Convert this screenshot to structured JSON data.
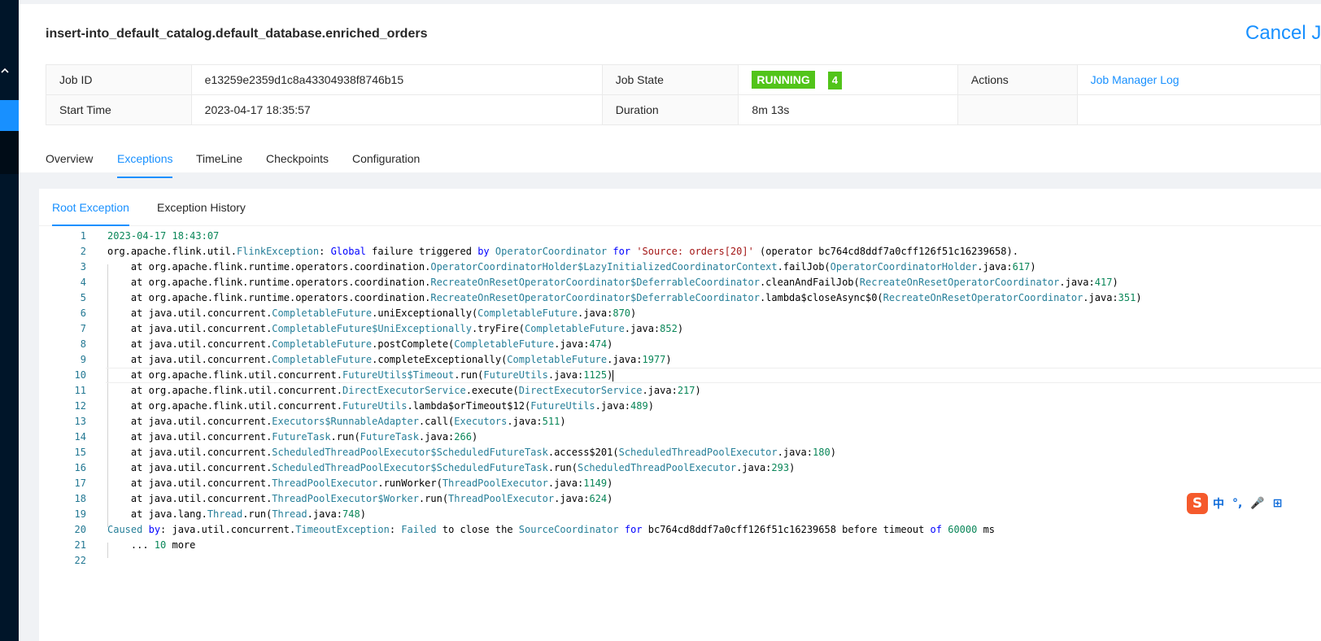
{
  "sidebar": {
    "collapse_icon": "chevron-up-icon"
  },
  "header": {
    "job_title": "insert-into_default_catalog.default_database.enriched_orders",
    "cancel_label": "Cancel Jo"
  },
  "job_info": {
    "job_id_label": "Job ID",
    "job_id": "e13259e2359d1c8a43304938f8746b15",
    "job_state_label": "Job State",
    "job_state": "RUNNING",
    "task_count": "4",
    "actions_label": "Actions",
    "job_manager_log": "Job Manager Log",
    "start_time_label": "Start Time",
    "start_time": "2023-04-17 18:35:57",
    "duration_label": "Duration",
    "duration": "8m 13s"
  },
  "nav_tabs": [
    "Overview",
    "Exceptions",
    "TimeLine",
    "Checkpoints",
    "Configuration"
  ],
  "sub_tabs": [
    "Root Exception",
    "Exception History"
  ],
  "code_lines": [
    [
      [
        "ts",
        "2023-04-17 18:43:07"
      ]
    ],
    [
      [
        "p",
        "org.apache.flink.util."
      ],
      [
        "t",
        "FlinkException"
      ],
      [
        "p",
        ": "
      ],
      [
        "k",
        "Global"
      ],
      [
        "p",
        " failure triggered "
      ],
      [
        "k",
        "by"
      ],
      [
        "p",
        " "
      ],
      [
        "t",
        "OperatorCoordinator"
      ],
      [
        "p",
        " "
      ],
      [
        "k",
        "for"
      ],
      [
        "p",
        " "
      ],
      [
        "s",
        "'Source: orders[20]'"
      ],
      [
        "p",
        " (operator bc764cd8ddf7a0cff126f51c16239658)."
      ]
    ],
    [
      [
        "p",
        "    at org.apache.flink.runtime.operators.coordination."
      ],
      [
        "t",
        "OperatorCoordinatorHolder$LazyInitializedCoordinatorContext"
      ],
      [
        "p",
        ".failJob("
      ],
      [
        "t",
        "OperatorCoordinatorHolder"
      ],
      [
        "p",
        ".java:"
      ],
      [
        "n",
        "617"
      ],
      [
        "p",
        ")"
      ]
    ],
    [
      [
        "p",
        "    at org.apache.flink.runtime.operators.coordination."
      ],
      [
        "t",
        "RecreateOnResetOperatorCoordinator$DeferrableCoordinator"
      ],
      [
        "p",
        ".cleanAndFailJob("
      ],
      [
        "t",
        "RecreateOnResetOperatorCoordinator"
      ],
      [
        "p",
        ".java:"
      ],
      [
        "n",
        "417"
      ],
      [
        "p",
        ")"
      ]
    ],
    [
      [
        "p",
        "    at org.apache.flink.runtime.operators.coordination."
      ],
      [
        "t",
        "RecreateOnResetOperatorCoordinator$DeferrableCoordinator"
      ],
      [
        "p",
        ".lambda$closeAsync$0("
      ],
      [
        "t",
        "RecreateOnResetOperatorCoordinator"
      ],
      [
        "p",
        ".java:"
      ],
      [
        "n",
        "351"
      ],
      [
        "p",
        ")"
      ]
    ],
    [
      [
        "p",
        "    at java.util.concurrent."
      ],
      [
        "t",
        "CompletableFuture"
      ],
      [
        "p",
        ".uniExceptionally("
      ],
      [
        "t",
        "CompletableFuture"
      ],
      [
        "p",
        ".java:"
      ],
      [
        "n",
        "870"
      ],
      [
        "p",
        ")"
      ]
    ],
    [
      [
        "p",
        "    at java.util.concurrent."
      ],
      [
        "t",
        "CompletableFuture$UniExceptionally"
      ],
      [
        "p",
        ".tryFire("
      ],
      [
        "t",
        "CompletableFuture"
      ],
      [
        "p",
        ".java:"
      ],
      [
        "n",
        "852"
      ],
      [
        "p",
        ")"
      ]
    ],
    [
      [
        "p",
        "    at java.util.concurrent."
      ],
      [
        "t",
        "CompletableFuture"
      ],
      [
        "p",
        ".postComplete("
      ],
      [
        "t",
        "CompletableFuture"
      ],
      [
        "p",
        ".java:"
      ],
      [
        "n",
        "474"
      ],
      [
        "p",
        ")"
      ]
    ],
    [
      [
        "p",
        "    at java.util.concurrent."
      ],
      [
        "t",
        "CompletableFuture"
      ],
      [
        "p",
        ".completeExceptionally("
      ],
      [
        "t",
        "CompletableFuture"
      ],
      [
        "p",
        ".java:"
      ],
      [
        "n",
        "1977"
      ],
      [
        "p",
        ")"
      ]
    ],
    [
      [
        "p",
        "    at org.apache.flink.util.concurrent."
      ],
      [
        "t",
        "FutureUtils$Timeout"
      ],
      [
        "p",
        ".run("
      ],
      [
        "t",
        "FutureUtils"
      ],
      [
        "p",
        ".java:"
      ],
      [
        "n",
        "1125"
      ],
      [
        "p",
        ")"
      ]
    ],
    [
      [
        "p",
        "    at org.apache.flink.util.concurrent."
      ],
      [
        "t",
        "DirectExecutorService"
      ],
      [
        "p",
        ".execute("
      ],
      [
        "t",
        "DirectExecutorService"
      ],
      [
        "p",
        ".java:"
      ],
      [
        "n",
        "217"
      ],
      [
        "p",
        ")"
      ]
    ],
    [
      [
        "p",
        "    at org.apache.flink.util.concurrent."
      ],
      [
        "t",
        "FutureUtils"
      ],
      [
        "p",
        ".lambda$orTimeout$12("
      ],
      [
        "t",
        "FutureUtils"
      ],
      [
        "p",
        ".java:"
      ],
      [
        "n",
        "489"
      ],
      [
        "p",
        ")"
      ]
    ],
    [
      [
        "p",
        "    at java.util.concurrent."
      ],
      [
        "t",
        "Executors$RunnableAdapter"
      ],
      [
        "p",
        ".call("
      ],
      [
        "t",
        "Executors"
      ],
      [
        "p",
        ".java:"
      ],
      [
        "n",
        "511"
      ],
      [
        "p",
        ")"
      ]
    ],
    [
      [
        "p",
        "    at java.util.concurrent."
      ],
      [
        "t",
        "FutureTask"
      ],
      [
        "p",
        ".run("
      ],
      [
        "t",
        "FutureTask"
      ],
      [
        "p",
        ".java:"
      ],
      [
        "n",
        "266"
      ],
      [
        "p",
        ")"
      ]
    ],
    [
      [
        "p",
        "    at java.util.concurrent."
      ],
      [
        "t",
        "ScheduledThreadPoolExecutor$ScheduledFutureTask"
      ],
      [
        "p",
        ".access$201("
      ],
      [
        "t",
        "ScheduledThreadPoolExecutor"
      ],
      [
        "p",
        ".java:"
      ],
      [
        "n",
        "180"
      ],
      [
        "p",
        ")"
      ]
    ],
    [
      [
        "p",
        "    at java.util.concurrent."
      ],
      [
        "t",
        "ScheduledThreadPoolExecutor$ScheduledFutureTask"
      ],
      [
        "p",
        ".run("
      ],
      [
        "t",
        "ScheduledThreadPoolExecutor"
      ],
      [
        "p",
        ".java:"
      ],
      [
        "n",
        "293"
      ],
      [
        "p",
        ")"
      ]
    ],
    [
      [
        "p",
        "    at java.util.concurrent."
      ],
      [
        "t",
        "ThreadPoolExecutor"
      ],
      [
        "p",
        ".runWorker("
      ],
      [
        "t",
        "ThreadPoolExecutor"
      ],
      [
        "p",
        ".java:"
      ],
      [
        "n",
        "1149"
      ],
      [
        "p",
        ")"
      ]
    ],
    [
      [
        "p",
        "    at java.util.concurrent."
      ],
      [
        "t",
        "ThreadPoolExecutor$Worker"
      ],
      [
        "p",
        ".run("
      ],
      [
        "t",
        "ThreadPoolExecutor"
      ],
      [
        "p",
        ".java:"
      ],
      [
        "n",
        "624"
      ],
      [
        "p",
        ")"
      ]
    ],
    [
      [
        "p",
        "    at java.lang."
      ],
      [
        "t",
        "Thread"
      ],
      [
        "p",
        ".run("
      ],
      [
        "t",
        "Thread"
      ],
      [
        "p",
        ".java:"
      ],
      [
        "n",
        "748"
      ],
      [
        "p",
        ")"
      ]
    ],
    [
      [
        "t",
        "Caused"
      ],
      [
        "p",
        " "
      ],
      [
        "k",
        "by"
      ],
      [
        "p",
        ": java.util.concurrent."
      ],
      [
        "t",
        "TimeoutException"
      ],
      [
        "p",
        ": "
      ],
      [
        "t",
        "Failed"
      ],
      [
        "p",
        " to close the "
      ],
      [
        "t",
        "SourceCoordinator"
      ],
      [
        "p",
        " "
      ],
      [
        "k",
        "for"
      ],
      [
        "p",
        " bc764cd8ddf7a0cff126f51c16239658 before timeout "
      ],
      [
        "k",
        "of"
      ],
      [
        "p",
        " "
      ],
      [
        "n",
        "60000"
      ],
      [
        "p",
        " ms"
      ]
    ],
    [
      [
        "p",
        "    ... "
      ],
      [
        "n",
        "10"
      ],
      [
        "p",
        " more"
      ]
    ],
    []
  ],
  "current_line": 10,
  "ime": {
    "logo": "S",
    "items": [
      "中",
      "°,",
      "🎤",
      "⊞"
    ]
  },
  "colors": {
    "accent": "#1890ff",
    "running": "#52c41a",
    "sidebar": "#001529"
  }
}
